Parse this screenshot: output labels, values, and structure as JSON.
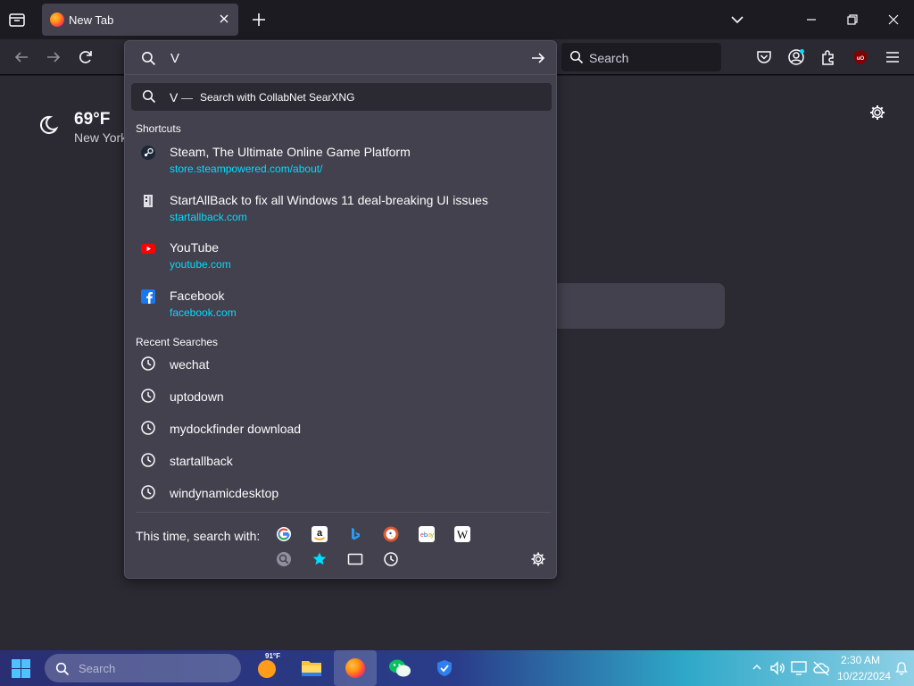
{
  "tab": {
    "title": "New Tab"
  },
  "toolbar": {
    "search_placeholder": "Search"
  },
  "weather": {
    "temp": "69°F",
    "location": "New York"
  },
  "urlbar": {
    "typed": "V"
  },
  "suggestion": {
    "term": "V",
    "separator": "—",
    "action": "Search with CollabNet SearXNG"
  },
  "shortcuts": {
    "label": "Shortcuts",
    "items": [
      {
        "title": "Steam, The Ultimate Online Game Platform",
        "url": "store.steampowered.com/about/",
        "icon": "steam-icon",
        "color": "#1b2838"
      },
      {
        "title": "StartAllBack to fix all Windows 11 deal-breaking UI issues",
        "url": "startallback.com",
        "icon": "startallback-icon",
        "color": "#e0e0e6"
      },
      {
        "title": "YouTube",
        "url": "youtube.com",
        "icon": "youtube-icon",
        "color": "#ff0000"
      },
      {
        "title": "Facebook",
        "url": "facebook.com",
        "icon": "facebook-icon",
        "color": "#1877f2"
      }
    ]
  },
  "recent": {
    "label": "Recent Searches",
    "items": [
      "wechat",
      "uptodown",
      "mydockfinder download",
      "startallback",
      "windynamicdesktop"
    ]
  },
  "oneoff": {
    "label": "This time, search with:",
    "engines": [
      "google-icon",
      "amazon-icon",
      "bing-icon",
      "duckduckgo-icon",
      "ebay-icon",
      "wikipedia-icon",
      "searxng-icon",
      "bookmarks-icon",
      "tabs-icon",
      "history-icon"
    ]
  },
  "taskbar": {
    "search_placeholder": "Search",
    "weather_badge": "91°F",
    "time": "2:30 AM",
    "date": "10/22/2024"
  },
  "colors": {
    "accent": "#00ddff",
    "popup_bg": "#42414d",
    "page_bg": "#2b2a33"
  }
}
